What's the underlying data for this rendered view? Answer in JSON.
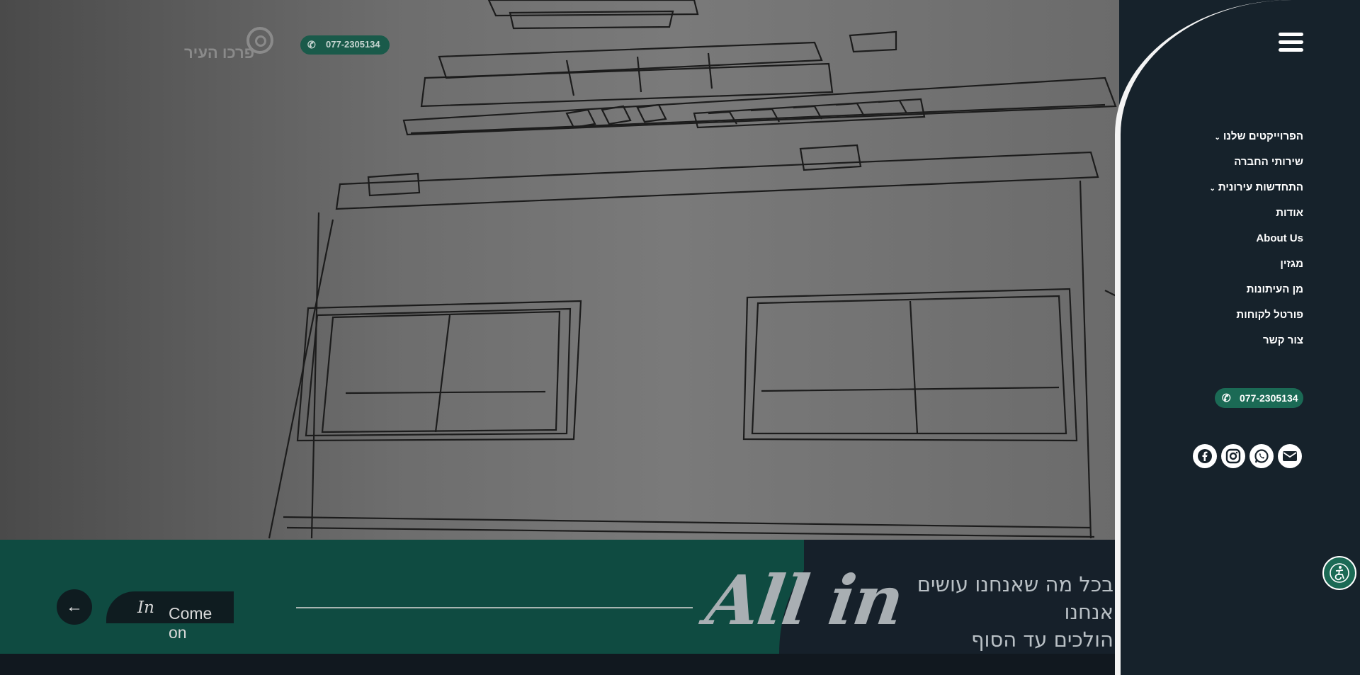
{
  "header": {
    "logo_text": "פרכו העיר",
    "phone": "077-2305134"
  },
  "hero": {
    "tagline_line1": "בכל מה שאנחנו עושים אנחנו",
    "tagline_line2": "הולכים עד הסוף",
    "all_in": "All in",
    "come_on": "Come on ",
    "come_on_script": "In"
  },
  "menu": {
    "items": [
      {
        "label": "הפרוייקטים שלנו",
        "dropdown": true
      },
      {
        "label": "שירותי החברה",
        "dropdown": false
      },
      {
        "label": "התחדשות עירונית",
        "dropdown": true
      },
      {
        "label": "אודות",
        "dropdown": false
      },
      {
        "label": "About Us",
        "dropdown": false
      },
      {
        "label": "מגזין",
        "dropdown": false
      },
      {
        "label": "מן העיתונות",
        "dropdown": false
      },
      {
        "label": "פורטל לקוחות",
        "dropdown": false
      },
      {
        "label": "צור קשר",
        "dropdown": false
      }
    ],
    "chevron": "⌄"
  },
  "side": {
    "phone": "077-2305134"
  },
  "icons": {
    "phone": "phone-icon",
    "menu": "hamburger-icon",
    "social": [
      "facebook-icon",
      "instagram-icon",
      "whatsapp-icon",
      "email-icon"
    ],
    "accessibility": "accessibility-icon",
    "arrow": "arrow-left-icon"
  },
  "colors": {
    "brand_green": "#1b6a55",
    "dark": "#16222b"
  }
}
